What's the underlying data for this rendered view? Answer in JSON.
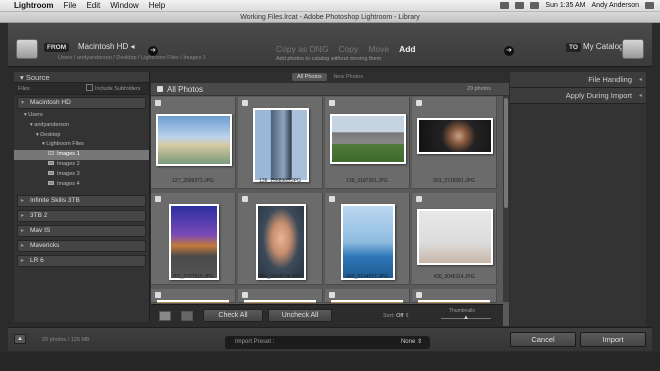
{
  "menubar": {
    "apple": "",
    "items": [
      "Lightroom",
      "File",
      "Edit",
      "Window",
      "Help"
    ],
    "right": [
      "Sun 1:35 AM",
      "Andy Anderson"
    ]
  },
  "window": {
    "title": "Working Files.lrcat - Adobe Photoshop Lightroom - Library"
  },
  "import_header": {
    "from_badge": "FROM",
    "from_name": "Macintosh HD ◂",
    "from_path": "Users / andyanderson / Desktop / Lightroom Files / Images 1",
    "modes": [
      "Copy as DNG",
      "Copy",
      "Move",
      "Add"
    ],
    "active_mode": "Add",
    "mode_desc": "Add photos to catalog without moving them",
    "to_badge": "TO",
    "to_name": "My Catalog"
  },
  "source_panel": {
    "title": "Source",
    "files_label": "Files",
    "include_subfolders": "Include Subfolders",
    "volume_open": "Macintosh HD",
    "tree": [
      {
        "label": "Users",
        "indent": 1,
        "folder": false,
        "arrow": "▾"
      },
      {
        "label": "andyanderson",
        "indent": 2,
        "folder": false,
        "arrow": "▾"
      },
      {
        "label": "Desktop",
        "indent": 3,
        "folder": false,
        "arrow": "▾"
      },
      {
        "label": "Lightroom Files",
        "indent": 4,
        "folder": false,
        "arrow": "▾"
      },
      {
        "label": "Images 1",
        "indent": 5,
        "folder": true,
        "selected": true
      },
      {
        "label": "Images 2",
        "indent": 5,
        "folder": true
      },
      {
        "label": "Images 3",
        "indent": 5,
        "folder": true
      },
      {
        "label": "Images 4",
        "indent": 5,
        "folder": true
      }
    ],
    "volumes": [
      "Infinite Skills 3TB",
      "3TB 2",
      "Mav IS",
      "Mavericks",
      "LR 6"
    ]
  },
  "grid": {
    "tabs": [
      "All Photos",
      "New Photos"
    ],
    "section_title": "All Photos",
    "count": "20 photos",
    "photos": [
      {
        "name": "127_2589372.JPG"
      },
      {
        "name": "136_2568965.JPG"
      },
      {
        "name": "136_3187281.JPG"
      },
      {
        "name": "201_2715581.JPG"
      },
      {
        "name": "201_2727819.JPG"
      },
      {
        "name": "285_2943174.JPG"
      },
      {
        "name": "430_3124527.JPG"
      },
      {
        "name": "436_3048114.JPG"
      }
    ],
    "check_all": "Check All",
    "uncheck_all": "Uncheck All",
    "sort_label": "Sort:",
    "sort_value": "Off",
    "thumbnails_label": "Thumbnails"
  },
  "right_panel": {
    "sections": [
      "File Handling",
      "Apply During Import"
    ]
  },
  "bottom": {
    "summary": "20 photos / 125 MB",
    "preset_label": "Import Preset :",
    "preset_value": "None",
    "cancel": "Cancel",
    "import": "Import"
  },
  "colors": {
    "panel": "#333333",
    "grid": "#5a5a5a",
    "cell": "#6b6b6b"
  }
}
